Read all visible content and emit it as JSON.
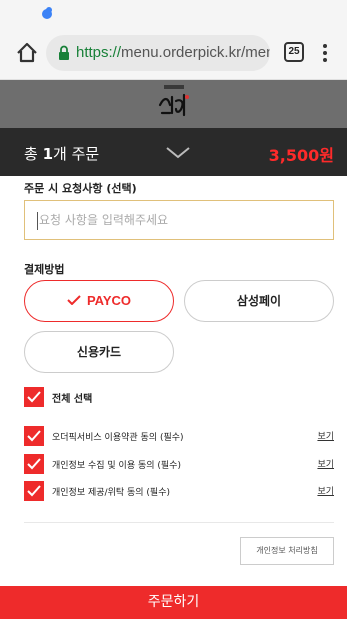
{
  "browser": {
    "url_scheme": "https://",
    "url_rest": "menu.orderpick.kr/men",
    "tab_count": "25"
  },
  "sheet": {
    "title_prefix": "총 ",
    "title_count": "1",
    "title_suffix": "개 주문",
    "total_price": "3,500원"
  },
  "request": {
    "label": "주문 시 요청사항 (선택)",
    "placeholder": "요청 사항을 입력해주세요",
    "value": ""
  },
  "payment": {
    "label": "결제방법",
    "options": [
      {
        "label": "PAYCO",
        "selected": true
      },
      {
        "label": "삼성페이",
        "selected": false
      },
      {
        "label": "신용카드",
        "selected": false
      }
    ]
  },
  "agreements": {
    "select_all_label": "전체 선택",
    "select_all_checked": true,
    "items": [
      {
        "label": "오더픽서비스 이용약관 동의 (필수)",
        "link": "보기",
        "checked": true
      },
      {
        "label": "개인정보 수집 및 이용 동의 (필수)",
        "link": "보기",
        "checked": true
      },
      {
        "label": "개인정보 제공/위탁 동의 (필수)",
        "link": "보기",
        "checked": true
      }
    ]
  },
  "privacy_policy_button": "개인정보 처리방침",
  "order_button": "주문하기",
  "colors": {
    "accent": "#ee2b2b",
    "header_bg": "#2a2a2a",
    "input_border": "#e0c07a"
  },
  "icons": {
    "status": "app-notification-icon",
    "home": "home-icon",
    "lock": "lock-icon",
    "menu": "more-vert-icon",
    "collapse": "chevron-down-icon",
    "logo": "restaurant-logo"
  }
}
